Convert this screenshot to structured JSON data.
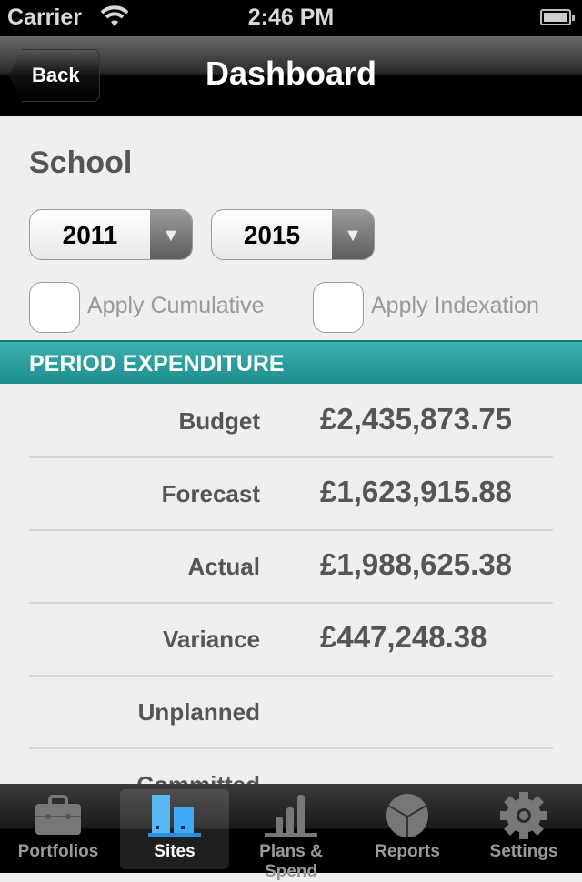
{
  "status_bar": {
    "carrier": "Carrier",
    "time": "2:46 PM"
  },
  "nav": {
    "back_label": "Back",
    "title": "Dashboard"
  },
  "site_name": "School",
  "filters": {
    "start_year": "2011",
    "end_year": "2015",
    "cumulative_label": "Apply Cumulative",
    "indexation_label": "Apply Indexation",
    "cumulative_checked": false,
    "indexation_checked": false
  },
  "section_title": "PERIOD EXPENDITURE",
  "rows": [
    {
      "label": "Budget",
      "value": "£2,435,873.75"
    },
    {
      "label": "Forecast",
      "value": "£1,623,915.88"
    },
    {
      "label": "Actual",
      "value": "£1,988,625.38"
    },
    {
      "label": "Variance",
      "value": "£447,248.38"
    },
    {
      "label": "Unplanned",
      "value": ""
    },
    {
      "label": "Committed",
      "value": ""
    }
  ],
  "tabs": [
    {
      "label": "Portfolios",
      "icon": "briefcase-icon"
    },
    {
      "label": "Sites",
      "icon": "buildings-icon",
      "active": true
    },
    {
      "label": "Plans & Spend",
      "icon": "bar-chart-icon"
    },
    {
      "label": "Reports",
      "icon": "pie-chart-icon"
    },
    {
      "label": "Settings",
      "icon": "gear-icon"
    }
  ],
  "colors": {
    "section_header": "#2a9a9a",
    "active_tab_icon": "#3fa9f5"
  }
}
